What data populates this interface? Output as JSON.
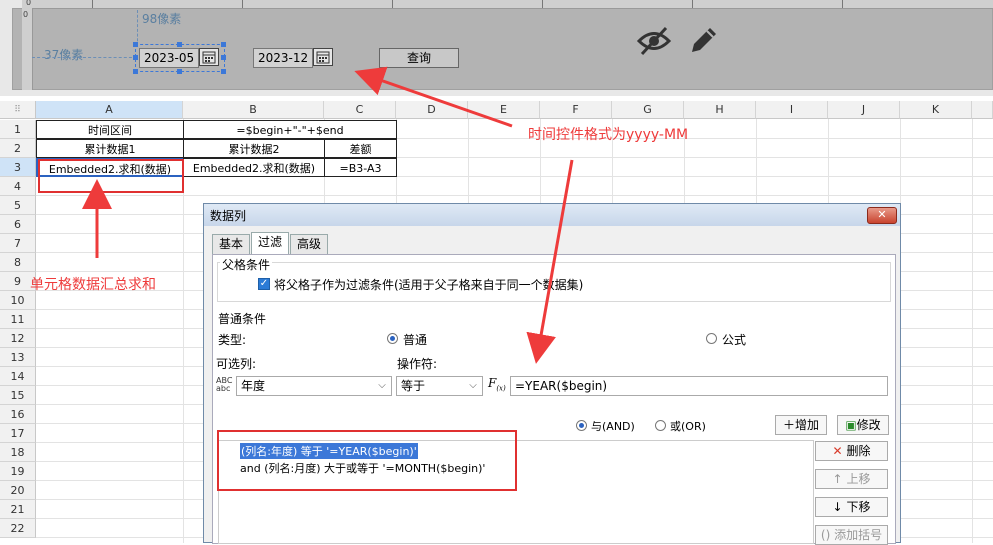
{
  "param_panel": {
    "dim_top": "98像素",
    "dim_left": "37像素",
    "date_start": "2023-05",
    "date_end": "2023-12",
    "query_label": "查询",
    "icons": [
      "calendar-icon",
      "eye-slash-icon",
      "pencil-icon"
    ]
  },
  "grid": {
    "columns": [
      "A",
      "B",
      "C",
      "D",
      "E",
      "F",
      "G",
      "H",
      "I",
      "J",
      "K"
    ],
    "rows": [
      "1",
      "2",
      "3",
      "4",
      "5",
      "6",
      "7",
      "8",
      "9",
      "10",
      "11",
      "12",
      "13",
      "14",
      "15",
      "16",
      "17",
      "18",
      "19",
      "20",
      "21",
      "22"
    ],
    "cells": {
      "a1": "时间区间",
      "b1": "=$begin+\"-\"+$end",
      "a2": "累计数据1",
      "b2": "累计数据2",
      "c2": "差额",
      "a3": "Embedded2.求和(数据)",
      "b3": "Embedded2.求和(数据)",
      "c3": "=B3-A3"
    }
  },
  "annotations": {
    "time_format": "时间控件格式为yyyy-MM",
    "cell_sum": "单元格数据汇总求和"
  },
  "dialog": {
    "title": "数据列",
    "close_symbol": "✕",
    "tabs": [
      "基本",
      "过滤",
      "高级"
    ],
    "active_tab": "过滤",
    "parent_section": "父格条件",
    "parent_checkbox_label": "将父格子作为过滤条件(适用于父子格来自于同一个数据集)",
    "normal_section": "普通条件",
    "type_label": "类型:",
    "type_normal": "普通",
    "type_formula": "公式",
    "column_label": "可选列:",
    "operator_label": "操作符:",
    "column_value": "年度",
    "operator_value": "等于",
    "formula_value": "=YEAR($begin)",
    "and_label": "与(AND)",
    "or_label": "或(OR)",
    "add_button": "增加",
    "modify_button": "修改",
    "delete_button": "删除",
    "up_button": "上移",
    "down_button": "下移",
    "bracket_button": "添加括号",
    "conditions": [
      "(列名:年度) 等于 '=YEAR($begin)'",
      "and (列名:月度) 大于或等于 '=MONTH($begin)'"
    ]
  },
  "colors": {
    "annotation_red": "#ee3b3b",
    "selection_blue": "#2b62c0"
  }
}
